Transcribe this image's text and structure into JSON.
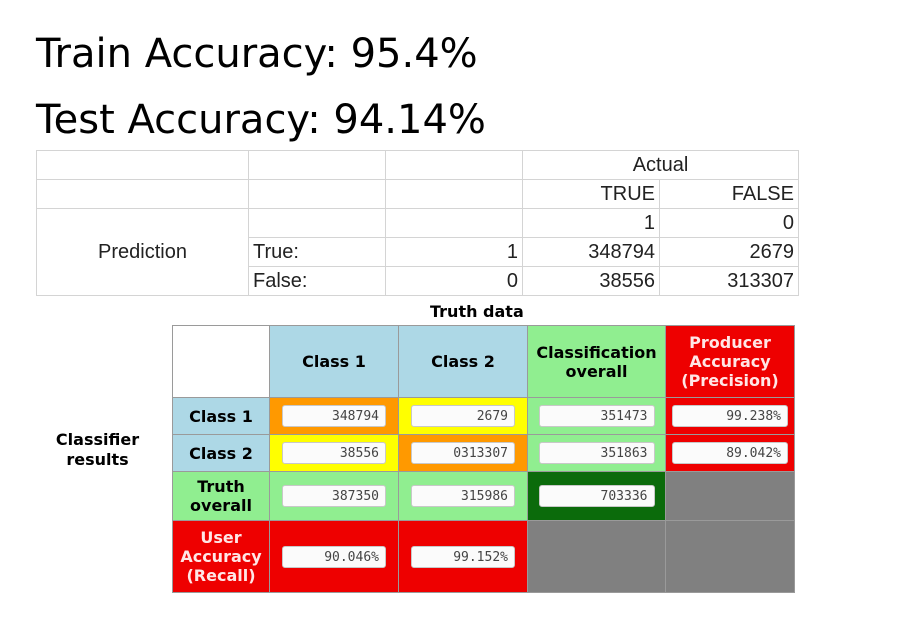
{
  "headings": {
    "train": "Train Accuracy: 95.4%",
    "test": "Test Accuracy: 94.14%"
  },
  "sheet": {
    "actual": "Actual",
    "true_label": "TRUE",
    "false_label": "FALSE",
    "one": "1",
    "zero": "0",
    "prediction": "Prediction",
    "row_true": "True:",
    "row_false": "False:",
    "row_true_code": "1",
    "row_false_code": "0",
    "tp": "348794",
    "fp": "2679",
    "fn": "38556",
    "tn": "313307"
  },
  "matrix": {
    "truth_title": "Truth data",
    "classifier_label": "Classifier results",
    "col_class1": "Class 1",
    "col_class2": "Class 2",
    "col_classification_overall": "Classification overall",
    "col_producer": "Producer Accuracy (Precision)",
    "row_class1": "Class 1",
    "row_class2": "Class 2",
    "row_truth_overall": "Truth overall",
    "row_user": "User Accuracy (Recall)",
    "c1_c1": "348794",
    "c1_c2": "2679",
    "c1_overall": "351473",
    "c1_producer": "99.238%",
    "c2_c1": "38556",
    "c2_c2": "0313307",
    "c2_overall": "351863",
    "c2_producer": "89.042%",
    "truth_c1": "387350",
    "truth_c2": "315986",
    "truth_overall": "703336",
    "user_c1": "90.046%",
    "user_c2": "99.152%"
  },
  "colors": {
    "light_blue": "#add8e6",
    "light_green": "#90ee90",
    "red": "#ee0000",
    "yellow": "#ffff00",
    "orange": "#ff9900",
    "dark_green": "#0b6b0b",
    "gray": "#808080"
  }
}
